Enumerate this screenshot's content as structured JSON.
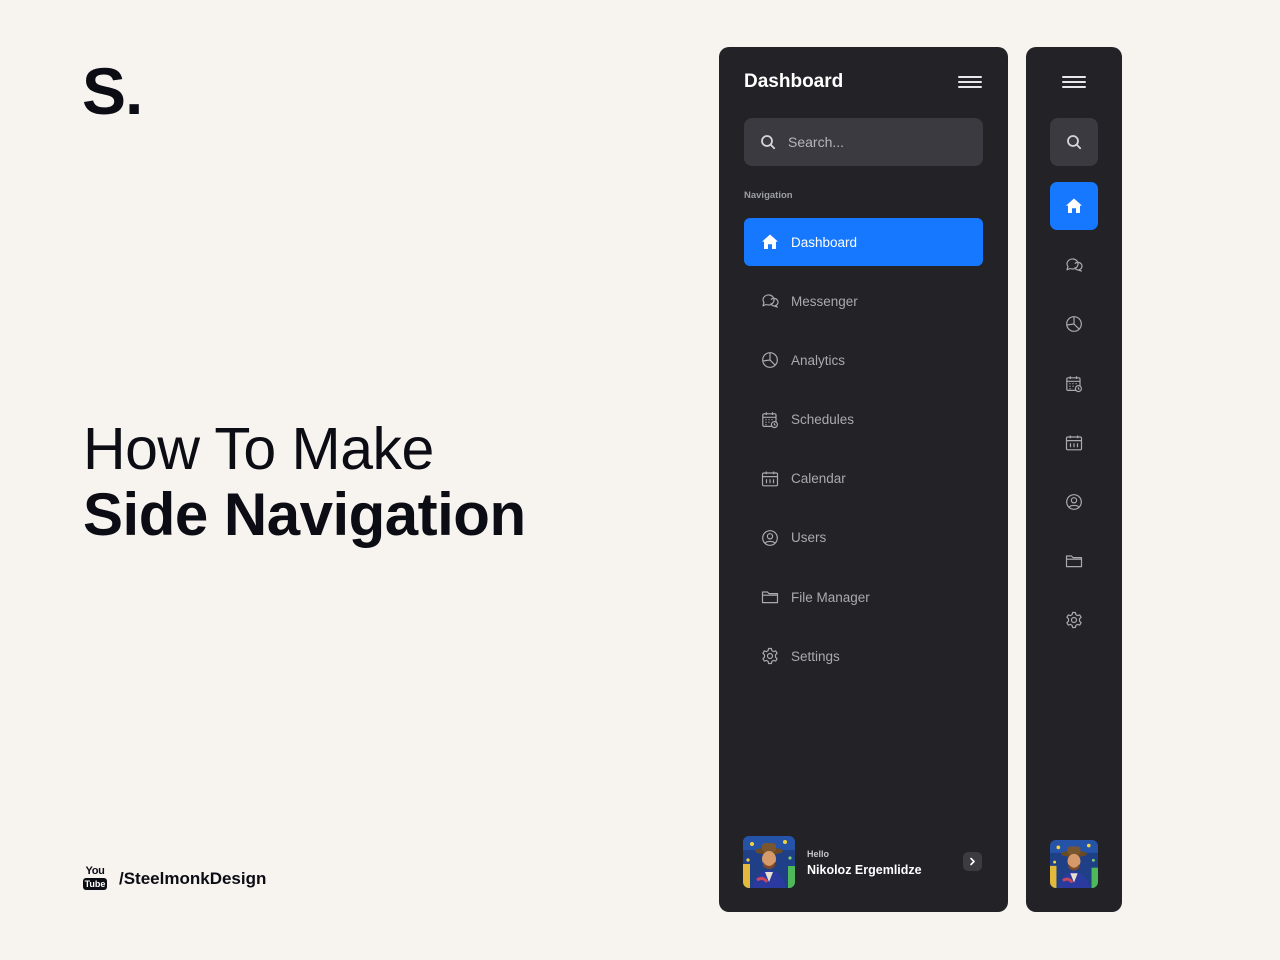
{
  "brand": {
    "logo": "S."
  },
  "headline": {
    "line1": "How To Make",
    "line2": "Side Navigation"
  },
  "channel": {
    "platform_top": "You",
    "platform_bottom": "Tube",
    "handle": "/SteelmonkDesign"
  },
  "colors": {
    "background": "#f7f4f0",
    "panel": "#222227",
    "accent": "#1677ff",
    "search_bg": "#3a3a40"
  },
  "sidebar": {
    "title": "Dashboard",
    "search": {
      "placeholder": "Search...",
      "value": ""
    },
    "section_label": "Navigation",
    "items": [
      {
        "label": "Dashboard",
        "icon": "home-icon",
        "active": true
      },
      {
        "label": "Messenger",
        "icon": "chat-icon",
        "active": false
      },
      {
        "label": "Analytics",
        "icon": "pie-chart-icon",
        "active": false
      },
      {
        "label": "Schedules",
        "icon": "schedule-icon",
        "active": false
      },
      {
        "label": "Calendar",
        "icon": "calendar-icon",
        "active": false
      },
      {
        "label": "Users",
        "icon": "user-icon",
        "active": false
      },
      {
        "label": "File Manager",
        "icon": "folder-icon",
        "active": false
      },
      {
        "label": "Settings",
        "icon": "gear-icon",
        "active": false
      }
    ],
    "user": {
      "greeting": "Hello",
      "name": "Nikoloz Ergemlidze"
    }
  }
}
